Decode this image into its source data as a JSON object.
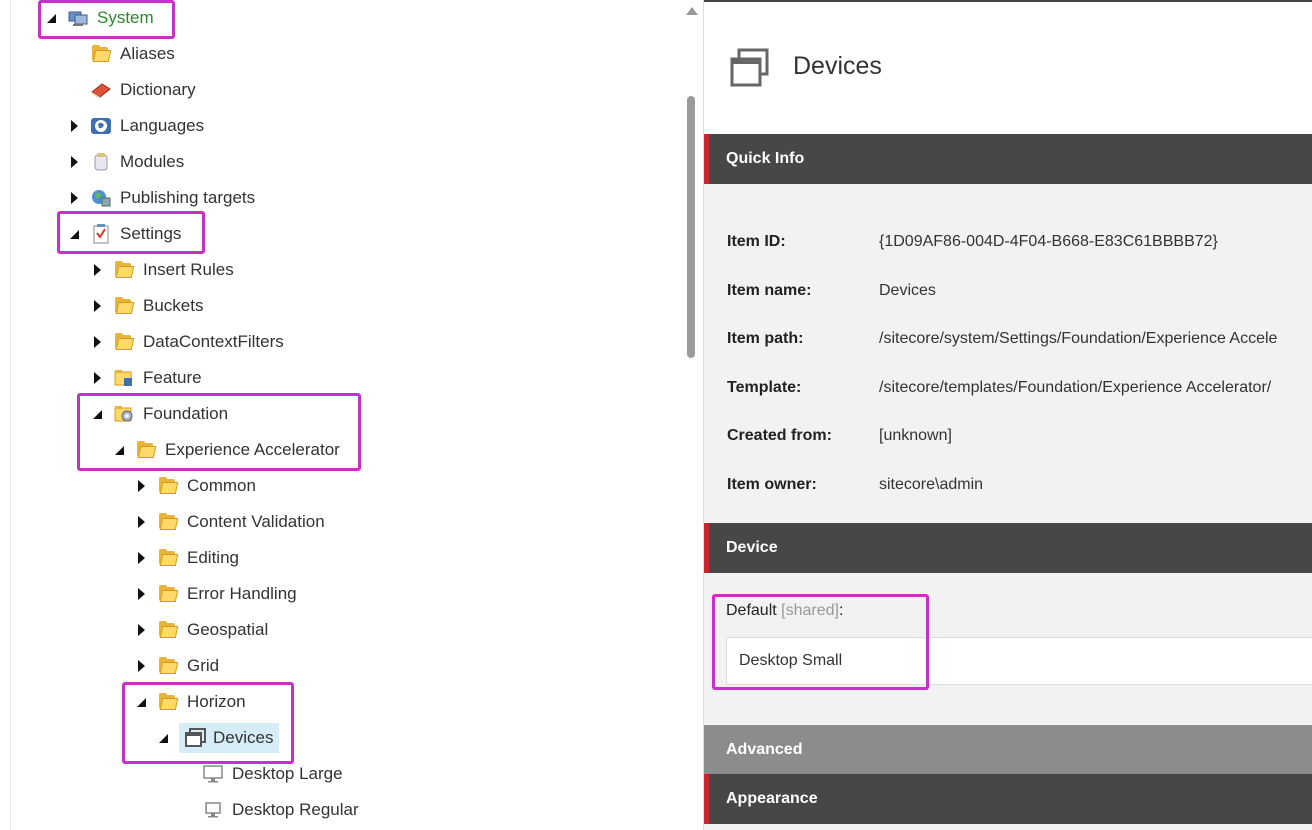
{
  "tree": {
    "items": [
      {
        "label": "System",
        "icon": "system-icon",
        "state": "expanded"
      },
      {
        "label": "Aliases",
        "icon": "folder-icon",
        "state": "leaf"
      },
      {
        "label": "Dictionary",
        "icon": "dictionary-icon",
        "state": "leaf"
      },
      {
        "label": "Languages",
        "icon": "globe-icon",
        "state": "collapsed"
      },
      {
        "label": "Modules",
        "icon": "modules-icon",
        "state": "collapsed"
      },
      {
        "label": "Publishing targets",
        "icon": "publishing-icon",
        "state": "collapsed"
      },
      {
        "label": "Settings",
        "icon": "settings-icon",
        "state": "expanded"
      },
      {
        "label": "Insert Rules",
        "icon": "folder-icon",
        "state": "collapsed"
      },
      {
        "label": "Buckets",
        "icon": "folder-icon",
        "state": "collapsed"
      },
      {
        "label": "DataContextFilters",
        "icon": "folder-icon",
        "state": "collapsed"
      },
      {
        "label": "Feature",
        "icon": "folder-feature-icon",
        "state": "collapsed"
      },
      {
        "label": "Foundation",
        "icon": "folder-foundation-icon",
        "state": "expanded"
      },
      {
        "label": "Experience Accelerator",
        "icon": "folder-icon",
        "state": "expanded"
      },
      {
        "label": "Common",
        "icon": "folder-icon",
        "state": "collapsed"
      },
      {
        "label": "Content Validation",
        "icon": "folder-icon",
        "state": "collapsed"
      },
      {
        "label": "Editing",
        "icon": "folder-icon",
        "state": "collapsed"
      },
      {
        "label": "Error Handling",
        "icon": "folder-icon",
        "state": "collapsed"
      },
      {
        "label": "Geospatial",
        "icon": "folder-icon",
        "state": "collapsed"
      },
      {
        "label": "Grid",
        "icon": "folder-icon",
        "state": "collapsed"
      },
      {
        "label": "Horizon",
        "icon": "folder-icon",
        "state": "expanded"
      },
      {
        "label": "Devices",
        "icon": "devices-icon",
        "state": "expanded"
      },
      {
        "label": "Desktop Large",
        "icon": "monitor-icon",
        "state": "leaf"
      },
      {
        "label": "Desktop Regular",
        "icon": "monitor-icon",
        "state": "leaf"
      }
    ]
  },
  "detail": {
    "title": "Devices",
    "title_icon": "devices-icon",
    "sections": {
      "quick_info": "Quick Info",
      "device": "Device",
      "advanced": "Advanced",
      "appearance": "Appearance"
    },
    "quick_info": [
      {
        "key": "Item ID:",
        "value": "{1D09AF86-004D-4F04-B668-E83C61BBBB72}"
      },
      {
        "key": "Item name:",
        "value": "Devices"
      },
      {
        "key": "Item path:",
        "value": "/sitecore/system/Settings/Foundation/Experience Accele"
      },
      {
        "key": "Template:",
        "value": "/sitecore/templates/Foundation/Experience Accelerator/"
      },
      {
        "key": "Created from:",
        "value": "[unknown]"
      },
      {
        "key": "Item owner:",
        "value": "sitecore\\admin"
      }
    ],
    "device_field": {
      "label": "Default",
      "shared": "[shared]",
      "colon": ":",
      "value": "Desktop Small"
    }
  },
  "colors": {
    "highlight": "#c930c9",
    "section_bar": "#474747",
    "section_accent": "#c8282d",
    "selected_bg": "#d6ecf7"
  }
}
